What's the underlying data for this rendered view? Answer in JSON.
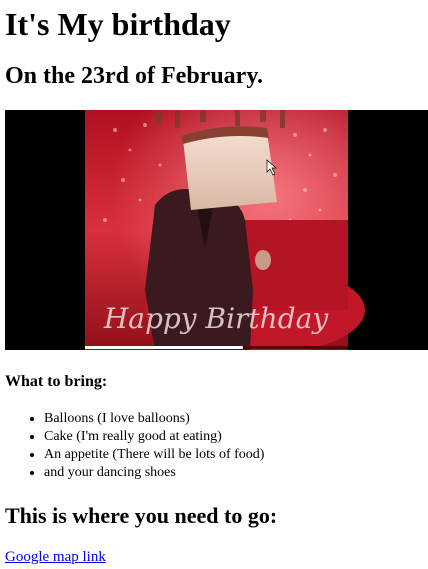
{
  "header": {
    "title": "It's My birthday",
    "date": "On the 23rd of February."
  },
  "video": {
    "overlay_text": "Happy Birthday",
    "progress": 0.6
  },
  "bring": {
    "title": "What to bring:",
    "items": [
      "Balloons (I love balloons)",
      "Cake (I'm really good at eating)",
      "An appetite (There will be lots of food)",
      "and your dancing shoes"
    ]
  },
  "location": {
    "title": "This is where you need to go:",
    "link_text": "Google map link"
  },
  "colors": {
    "link": "#0000ee",
    "video_background": "#000000",
    "scene_red": "#d0202c"
  }
}
